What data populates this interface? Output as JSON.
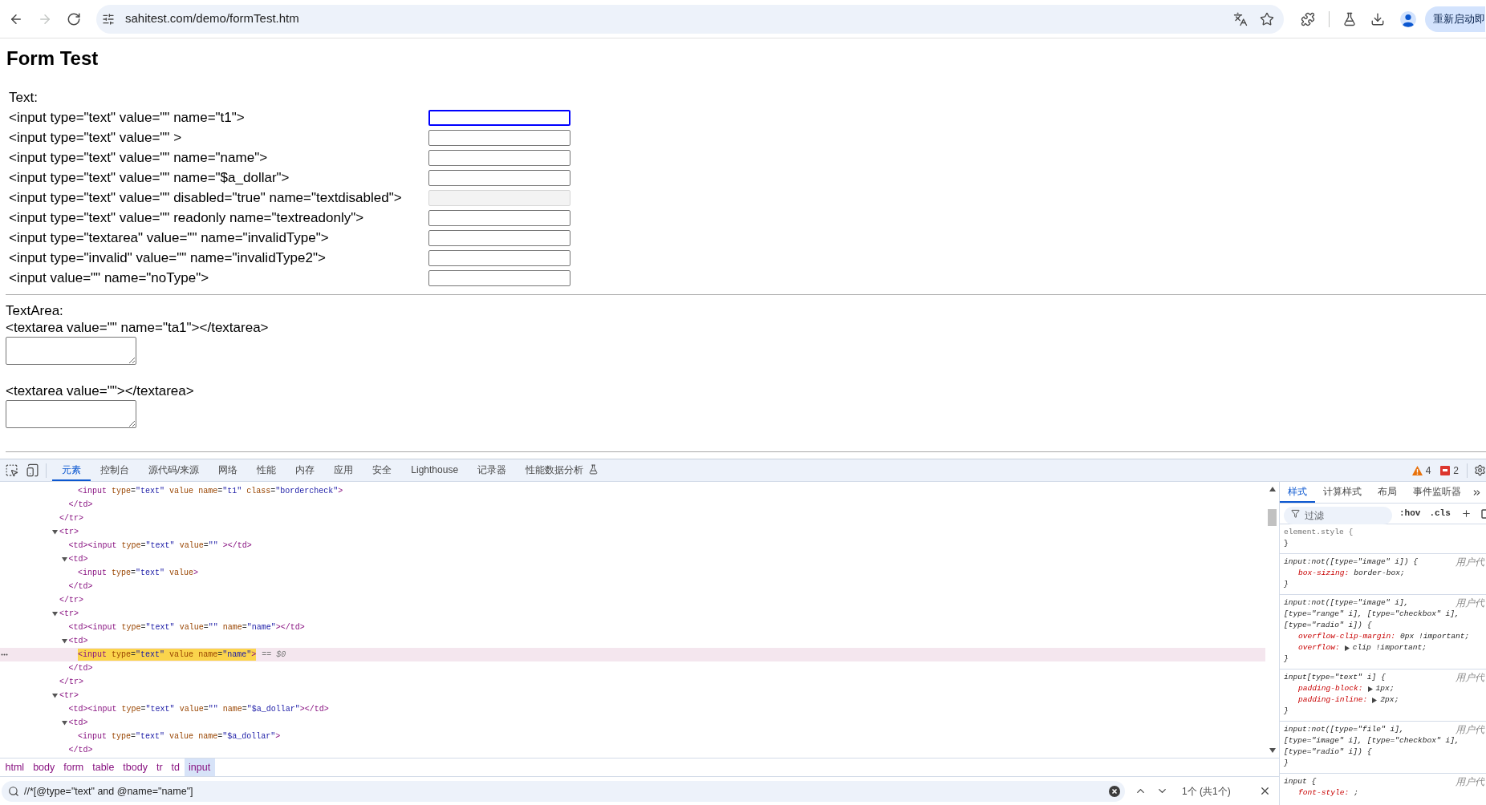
{
  "toolbar": {
    "buttons": [
      {
        "kind": "back",
        "disabled": false
      },
      {
        "kind": "forward",
        "disabled": true
      },
      {
        "kind": "reload",
        "disabled": false
      }
    ],
    "url": "sahitest.com/demo/formTest.htm",
    "relaunch_label": "重新启动即"
  },
  "page": {
    "heading": "Form Test",
    "text_section": {
      "title": "Text:",
      "rows": [
        {
          "label": "<input type=\"text\" value=\"\" name=\"t1\">",
          "focused": true,
          "disabled": false
        },
        {
          "label": "<input type=\"text\" value=\"\" >",
          "focused": false,
          "disabled": false
        },
        {
          "label": "<input type=\"text\" value=\"\" name=\"name\">",
          "focused": false,
          "disabled": false
        },
        {
          "label": "<input type=\"text\" value=\"\" name=\"$a_dollar\">",
          "focused": false,
          "disabled": false
        },
        {
          "label": "<input type=\"text\" value=\"\" disabled=\"true\" name=\"textdisabled\">",
          "focused": false,
          "disabled": true
        },
        {
          "label": "<input type=\"text\" value=\"\" readonly name=\"textreadonly\">",
          "focused": false,
          "disabled": false
        },
        {
          "label": "<input type=\"textarea\" value=\"\" name=\"invalidType\">",
          "focused": false,
          "disabled": false
        },
        {
          "label": "<input type=\"invalid\" value=\"\" name=\"invalidType2\">",
          "focused": false,
          "disabled": false
        },
        {
          "label": "<input value=\"\" name=\"noType\">",
          "focused": false,
          "disabled": false
        }
      ]
    },
    "textarea_section": {
      "title": "TextArea:",
      "items": [
        {
          "label": "<textarea value=\"\" name=\"ta1\"></textarea>"
        },
        {
          "label": "<textarea value=\"\"></textarea>"
        }
      ]
    }
  },
  "devtools": {
    "tabs": [
      {
        "label": "元素",
        "selected": true,
        "experimental": false
      },
      {
        "label": "控制台",
        "selected": false,
        "experimental": false
      },
      {
        "label": "源代码/来源",
        "selected": false,
        "experimental": false
      },
      {
        "label": "网络",
        "selected": false,
        "experimental": false
      },
      {
        "label": "性能",
        "selected": false,
        "experimental": false
      },
      {
        "label": "内存",
        "selected": false,
        "experimental": false
      },
      {
        "label": "应用",
        "selected": false,
        "experimental": false
      },
      {
        "label": "安全",
        "selected": false,
        "experimental": false
      },
      {
        "label": "Lighthouse",
        "selected": false,
        "experimental": false
      },
      {
        "label": "记录器",
        "selected": false,
        "experimental": false
      },
      {
        "label": "性能数据分析",
        "selected": false,
        "experimental": true
      }
    ],
    "issues": [
      {
        "kind": "warning",
        "count": "4"
      },
      {
        "kind": "error",
        "count": "2"
      }
    ],
    "elements_tree": [
      {
        "close": "</tr>",
        "children": [
          {
            "close": "</td>",
            "children": [
              {
                "open": "<input type=\"text\" value name=\"t1\" class=\"bordercheck\">",
                "selected": false,
                "match": false
              }
            ]
          }
        ]
      },
      {
        "open": "<tr>",
        "expanded": true,
        "selected": false,
        "match": false,
        "children": [
          {
            "open": "<td><input type=\"text\" value=\"\" ></td>",
            "selected": false,
            "match": false
          },
          {
            "open": "<td>",
            "expanded": true,
            "selected": false,
            "match": false,
            "children": [
              {
                "open": "<input type=\"text\" value>",
                "selected": false,
                "match": false
              }
            ],
            "close": "</td>"
          }
        ],
        "close": "</tr>"
      },
      {
        "open": "<tr>",
        "expanded": true,
        "selected": false,
        "match": false,
        "children": [
          {
            "open": "<td><input type=\"text\" value=\"\" name=\"name\"></td>",
            "selected": false,
            "match": false
          },
          {
            "open": "<td>",
            "expanded": true,
            "selected": false,
            "match": false,
            "children": [
              {
                "open": "<input type=\"text\" value name=\"name\">",
                "selected": true,
                "match": true,
                "suffix": "== $0"
              }
            ],
            "close": "</td>"
          }
        ],
        "close": "</tr>"
      },
      {
        "open": "<tr>",
        "expanded": true,
        "selected": false,
        "match": false,
        "children": [
          {
            "open": "<td><input type=\"text\" value=\"\" name=\"$a_dollar\"></td>",
            "selected": false,
            "match": false
          },
          {
            "open": "<td>",
            "expanded": true,
            "selected": false,
            "match": false,
            "children": [
              {
                "open": "<input type=\"text\" value name=\"$a_dollar\">",
                "selected": false,
                "match": false
              }
            ],
            "close": "</td>"
          }
        ]
      }
    ],
    "breadcrumbs": [
      {
        "label": "html",
        "selected": false
      },
      {
        "label": "body",
        "selected": false
      },
      {
        "label": "form",
        "selected": false
      },
      {
        "label": "table",
        "selected": false
      },
      {
        "label": "tbody",
        "selected": false
      },
      {
        "label": "tr",
        "selected": false
      },
      {
        "label": "td",
        "selected": false
      },
      {
        "label": "input",
        "selected": true
      }
    ],
    "search": {
      "value": "//*[@type=\"text\" and @name=\"name\"]",
      "result": "1个 (共1个)"
    },
    "styles": {
      "tabs": [
        {
          "label": "样式",
          "selected": true
        },
        {
          "label": "计算样式",
          "selected": false
        },
        {
          "label": "布局",
          "selected": false
        },
        {
          "label": "事件监听器",
          "selected": false
        }
      ],
      "filter_placeholder": "过滤",
      "toggles": [
        ":hov",
        ".cls"
      ],
      "rules": [
        {
          "kind": "inline",
          "selector": [
            "element.style {"
          ],
          "close": "}"
        },
        {
          "kind": "user_agent",
          "selector": [
            "input:not([type=\"image\" i]) {"
          ],
          "origin": "用户代",
          "declarations": [
            {
              "property": "box-sizing:",
              "value": "border-box;",
              "expandable": false
            }
          ],
          "close": "}"
        },
        {
          "kind": "user_agent",
          "selector": [
            "input:not([type=\"image\" i],",
            "[type=\"range\" i], [type=\"checkbox\" i],",
            "[type=\"radio\" i]) {"
          ],
          "origin": "用户代",
          "declarations": [
            {
              "property": "overflow-clip-margin:",
              "value": "0px !important;",
              "expandable": false
            },
            {
              "property": "overflow:",
              "value": "clip !important;",
              "expandable": true
            }
          ],
          "close": "}"
        },
        {
          "kind": "user_agent",
          "selector": [
            "input[type=\"text\" i] {"
          ],
          "origin": "用户代",
          "declarations": [
            {
              "property": "padding-block:",
              "value": "1px;",
              "expandable": true
            },
            {
              "property": "padding-inline:",
              "value": "2px;",
              "expandable": true
            }
          ],
          "close": "}"
        },
        {
          "kind": "user_agent",
          "selector": [
            "input:not([type=\"file\" i],",
            "[type=\"image\" i], [type=\"checkbox\" i],",
            "[type=\"radio\" i]) {"
          ],
          "origin": "用户代",
          "close": "}"
        },
        {
          "kind": "user_agent",
          "selector": [
            "input {"
          ],
          "origin": "用户代",
          "declarations": [
            {
              "property": "font-style:",
              "value": ";",
              "expandable": false
            }
          ]
        }
      ]
    }
  }
}
